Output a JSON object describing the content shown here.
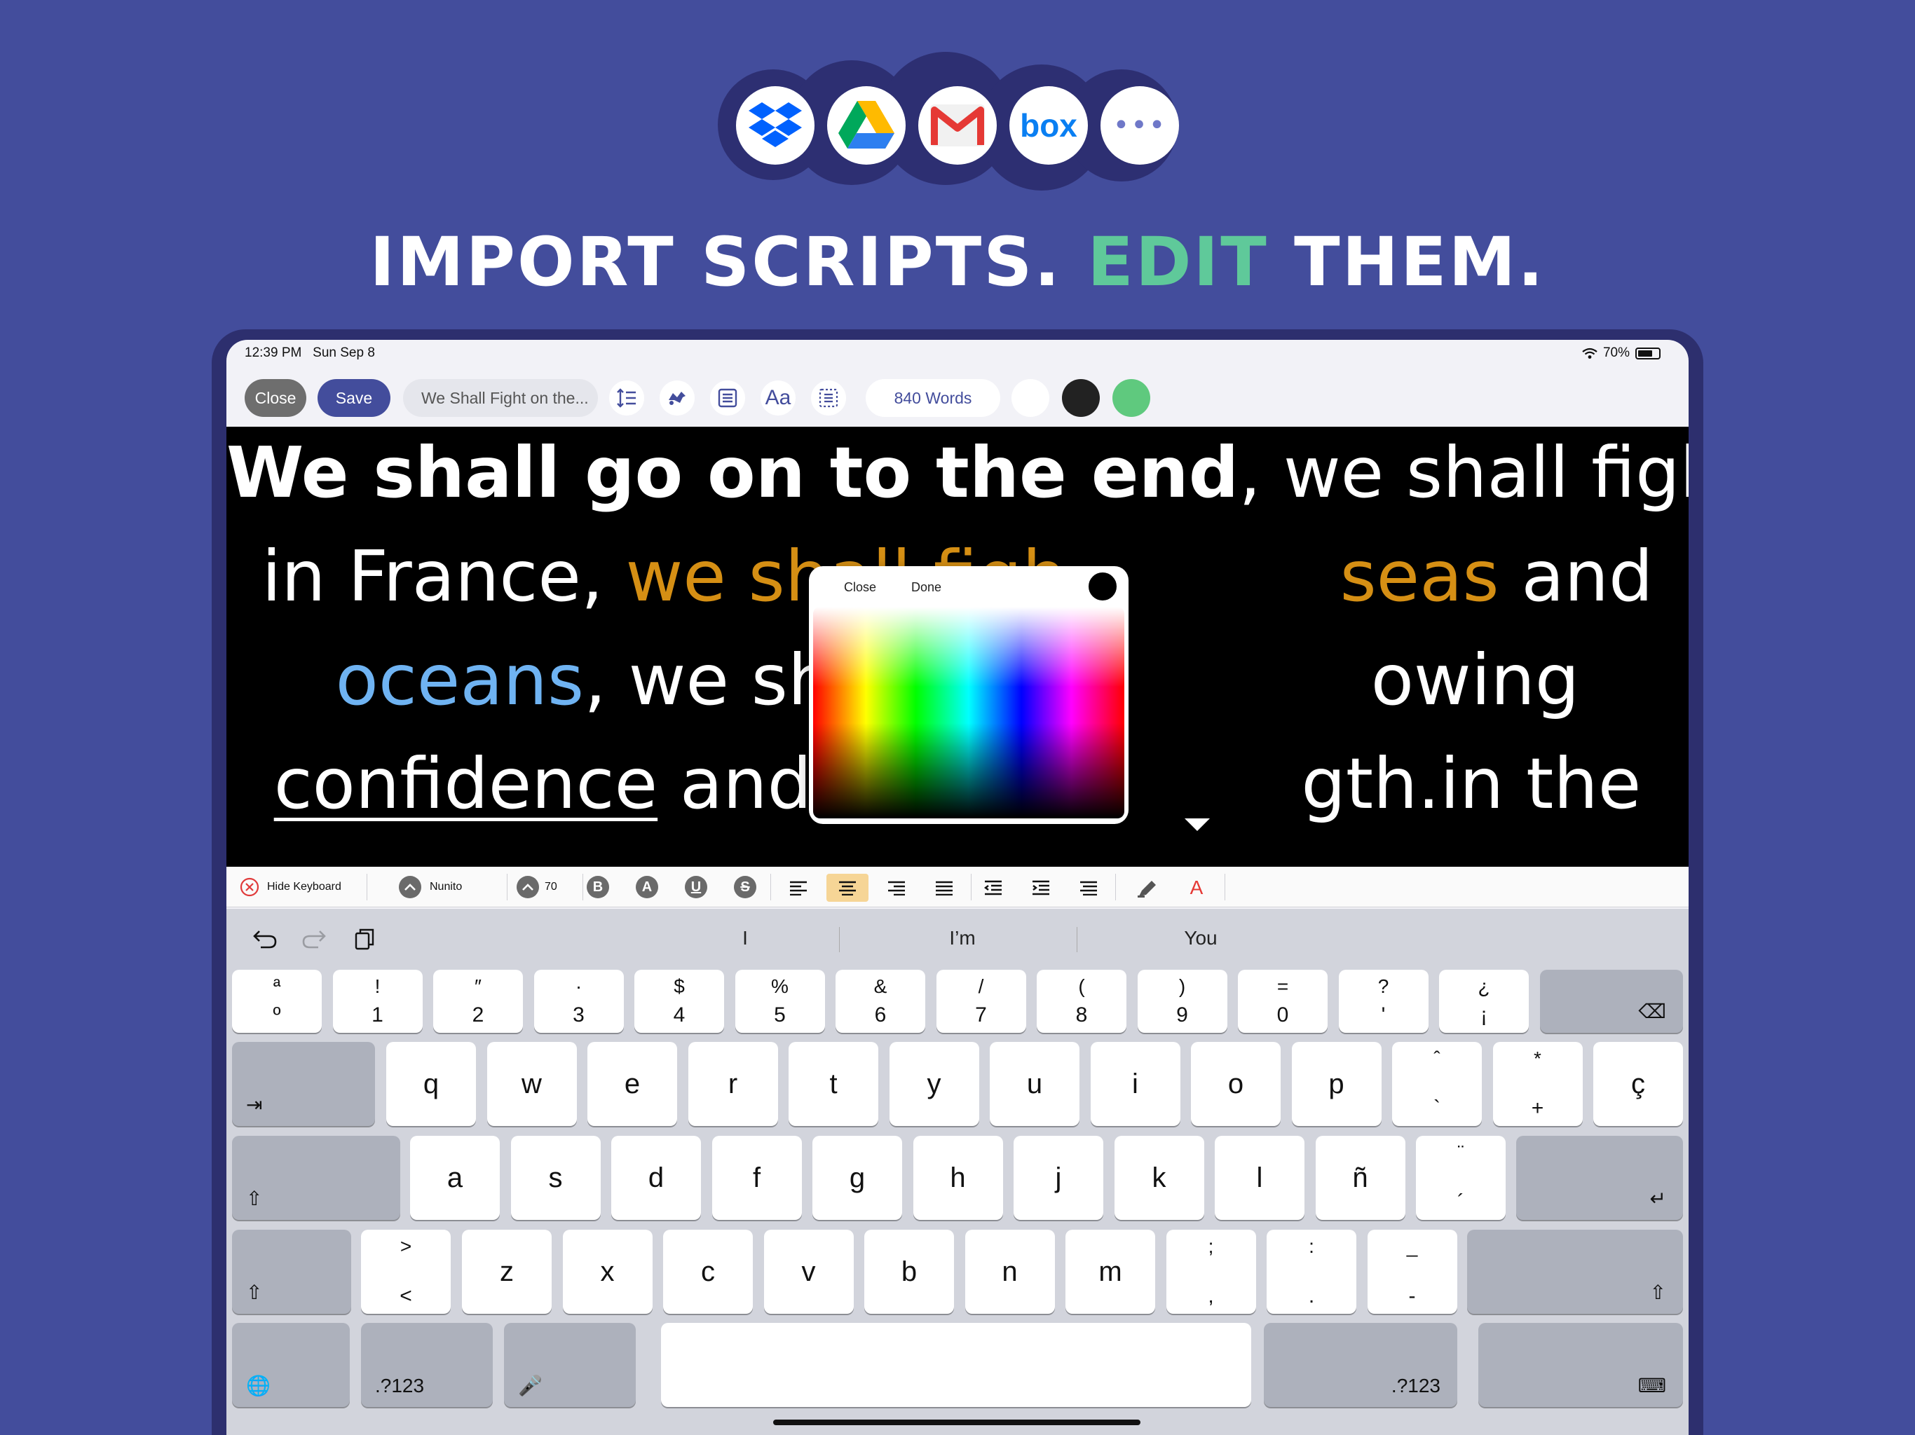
{
  "promo": {
    "headline_part1": "IMPORT SCRIPTS.",
    "headline_accent": "EDIT",
    "headline_part2": "THEM.",
    "services": [
      "dropbox-icon",
      "google-drive-icon",
      "gmail-icon",
      "box-icon",
      "more-icon"
    ],
    "box_label": "box",
    "more_label": "•••"
  },
  "status": {
    "time": "12:39 PM",
    "date": "Sun Sep 8",
    "battery": "70%",
    "battery_level": 0.7
  },
  "toolbar": {
    "close_label": "Close",
    "save_label": "Save",
    "doc_title": "We Shall Fight on the...",
    "word_count": "840 Words",
    "aa_label": "Aa"
  },
  "script": {
    "line1_bold": "We shall go on to the end",
    "line1_rest": ", we shall fight",
    "line2_start": "in France, ",
    "line2_orange1": "we shall figh",
    "line2_orange2": "seas",
    "line2_end": " and",
    "line3_blue": "oceans",
    "line3_mid": ", we shall figh",
    "line3_end": "owing",
    "line4_underline": "confidence",
    "line4_mid": " and growin",
    "line4_end": "gth.in the"
  },
  "picker": {
    "close_label": "Close",
    "done_label": "Done"
  },
  "format_bar": {
    "hide_keyboard": "Hide Keyboard",
    "font_name": "Nunito",
    "font_size": "70",
    "style_buttons": [
      "B",
      "A",
      "U",
      "S"
    ],
    "text_color_label": "A"
  },
  "keyboard": {
    "predictions": [
      "I",
      "I’m",
      "You"
    ],
    "number_row": [
      {
        "top": "ª",
        "bot": "º"
      },
      {
        "top": "!",
        "bot": "1"
      },
      {
        "top": "″",
        "bot": "2"
      },
      {
        "top": "·",
        "bot": "3"
      },
      {
        "top": "$",
        "bot": "4"
      },
      {
        "top": "%",
        "bot": "5"
      },
      {
        "top": "&",
        "bot": "6"
      },
      {
        "top": "/",
        "bot": "7"
      },
      {
        "top": "(",
        "bot": "8"
      },
      {
        "top": ")",
        "bot": "9"
      },
      {
        "top": "=",
        "bot": "0"
      },
      {
        "top": "?",
        "bot": "'"
      },
      {
        "top": "¿",
        "bot": "¡"
      }
    ],
    "row1": [
      "q",
      "w",
      "e",
      "r",
      "t",
      "y",
      "u",
      "i",
      "o",
      "p"
    ],
    "row1_extra": [
      {
        "top": "ˆ",
        "bot": "`"
      },
      {
        "top": "*",
        "bot": "+"
      },
      {
        "main": "ç"
      }
    ],
    "row2": [
      "a",
      "s",
      "d",
      "f",
      "g",
      "h",
      "j",
      "k",
      "l",
      "ñ"
    ],
    "row2_extra": {
      "top": "¨",
      "bot": "´"
    },
    "row3_first": {
      "top": ">",
      "bot": "<"
    },
    "row3": [
      "z",
      "x",
      "c",
      "v",
      "b",
      "n",
      "m"
    ],
    "row3_extra": [
      {
        "top": ";",
        "bot": ","
      },
      {
        "top": ":",
        "bot": "."
      },
      {
        "top": "_",
        "bot": "-"
      }
    ],
    "numbers_label": ".?123",
    "backspace_icon": "⌫",
    "tab_icon": "⇥",
    "return_icon": "↵",
    "shift_icon": "⇧",
    "globe_icon": "🌐",
    "mic_icon": "🎤",
    "keyboard_icon": "⌨"
  },
  "colors": {
    "background": "#434d9c",
    "accent": "#5fc99a",
    "orange": "#d58f14",
    "blue": "#6fb3f2",
    "save": "#434d9c"
  }
}
